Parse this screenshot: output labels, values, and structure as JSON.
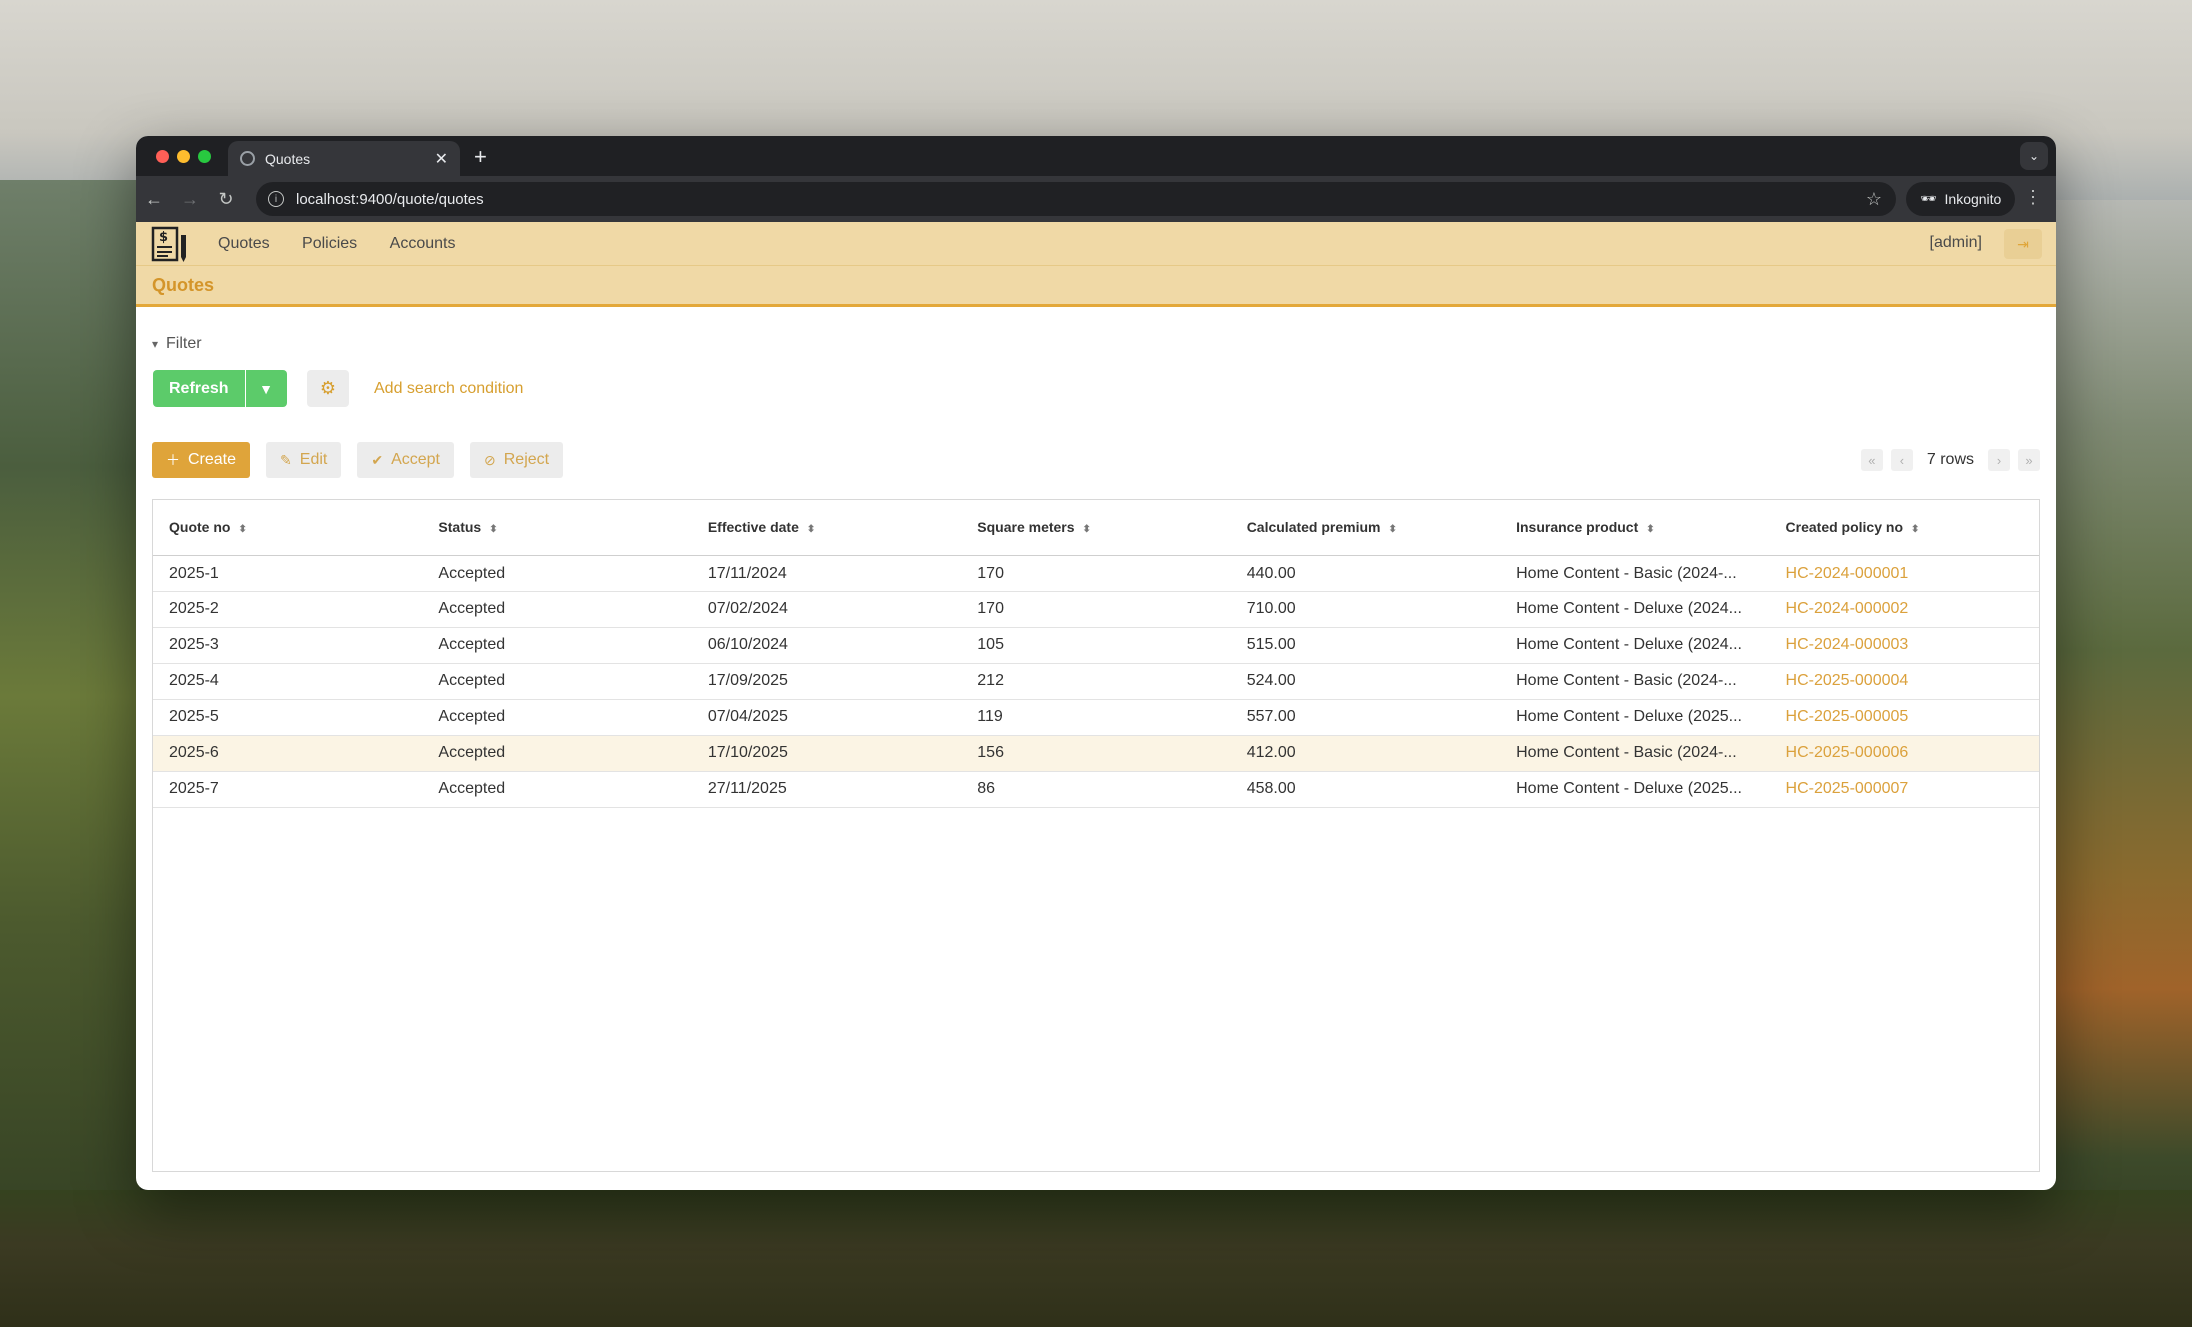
{
  "browser": {
    "tab_title": "Quotes",
    "url": "localhost:9400/quote/quotes",
    "profile_label": "Inkognito"
  },
  "app": {
    "nav": [
      "Quotes",
      "Policies",
      "Accounts"
    ],
    "user": "[admin]",
    "page_title": "Quotes"
  },
  "filter": {
    "toggle_label": "Filter",
    "refresh_label": "Refresh",
    "add_condition_label": "Add search condition"
  },
  "actions": {
    "create": "Create",
    "edit": "Edit",
    "accept": "Accept",
    "reject": "Reject"
  },
  "pager": {
    "rows_label": "7 rows"
  },
  "table": {
    "columns": [
      "Quote no",
      "Status",
      "Effective date",
      "Square meters",
      "Calculated premium",
      "Insurance product",
      "Created policy no"
    ],
    "rows": [
      [
        "2025-1",
        "Accepted",
        "17/11/2024",
        "170",
        "440.00",
        "Home Content - Basic (2024-...",
        "HC-2024-000001"
      ],
      [
        "2025-2",
        "Accepted",
        "07/02/2024",
        "170",
        "710.00",
        "Home Content - Deluxe (2024...",
        "HC-2024-000002"
      ],
      [
        "2025-3",
        "Accepted",
        "06/10/2024",
        "105",
        "515.00",
        "Home Content - Deluxe (2024...",
        "HC-2024-000003"
      ],
      [
        "2025-4",
        "Accepted",
        "17/09/2025",
        "212",
        "524.00",
        "Home Content - Basic (2024-...",
        "HC-2025-000004"
      ],
      [
        "2025-5",
        "Accepted",
        "07/04/2025",
        "119",
        "557.00",
        "Home Content - Deluxe (2025...",
        "HC-2025-000005"
      ],
      [
        "2025-6",
        "Accepted",
        "17/10/2025",
        "156",
        "412.00",
        "Home Content - Basic (2024-...",
        "HC-2025-000006"
      ],
      [
        "2025-7",
        "Accepted",
        "27/11/2025",
        "86",
        "458.00",
        "Home Content - Deluxe (2025...",
        "HC-2025-000007"
      ]
    ],
    "highlighted_row": 5
  },
  "colors": {
    "accent": "#dfa43a",
    "header_bg": "#f0d9a6",
    "refresh_green": "#5ccb6a",
    "link": "#dba13c"
  }
}
